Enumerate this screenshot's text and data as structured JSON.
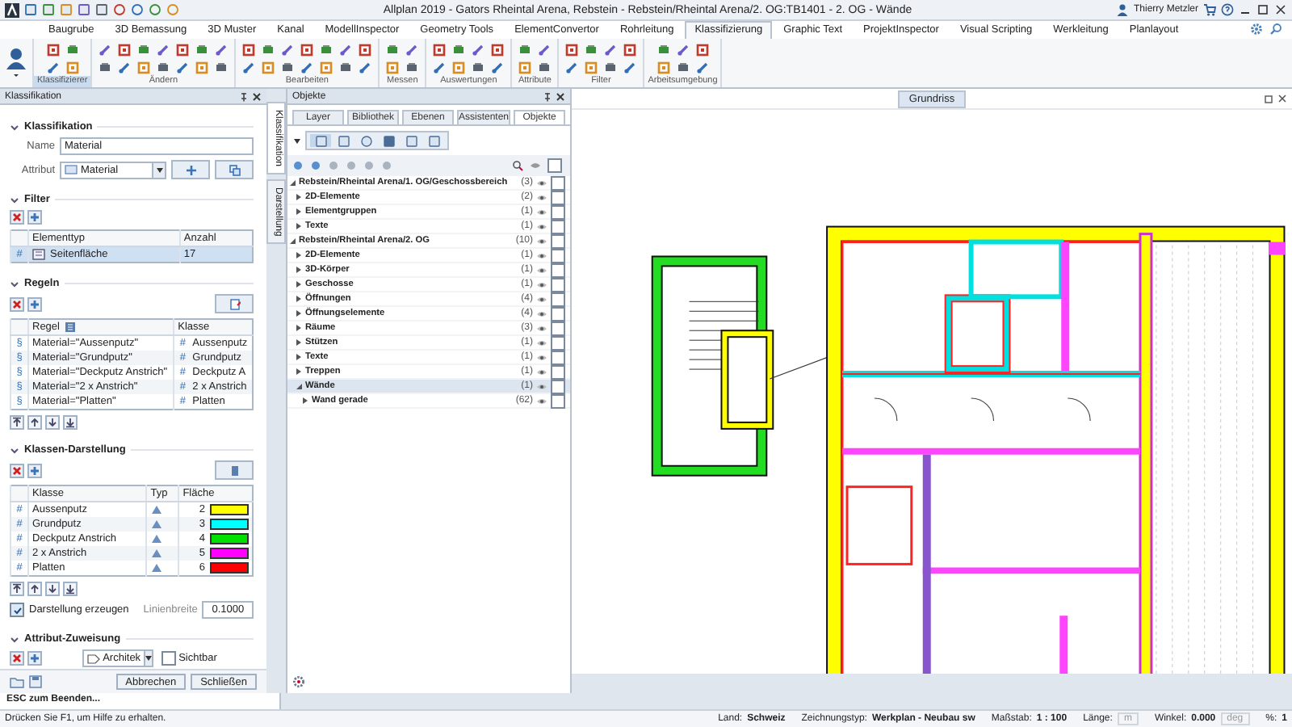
{
  "window": {
    "title": "Allplan 2019 - Gators Rheintal Arena, Rebstein - Rebstein/Rheintal Arena/2. OG:TB1401 - 2. OG - Wände",
    "user": "Thierry Metzler"
  },
  "ribbon": {
    "tabs": [
      {
        "label": "Baugrube",
        "selected": false
      },
      {
        "label": "3D Bemassung",
        "selected": false
      },
      {
        "label": "3D Muster",
        "selected": false
      },
      {
        "label": "Kanal",
        "selected": false
      },
      {
        "label": "ModellInspector",
        "selected": false
      },
      {
        "label": "Geometry Tools",
        "selected": false
      },
      {
        "label": "ElementConvertor",
        "selected": false
      },
      {
        "label": "Rohrleitung",
        "selected": false
      },
      {
        "label": "Klassifizierung",
        "selected": true
      },
      {
        "label": "Graphic Text",
        "selected": false
      },
      {
        "label": "ProjektInspector",
        "selected": false
      },
      {
        "label": "Visual Scripting",
        "selected": false
      },
      {
        "label": "Werkleitung",
        "selected": false
      },
      {
        "label": "Planlayout",
        "selected": false
      }
    ],
    "groups": [
      {
        "label": "Klassifizierer",
        "selected": true
      },
      {
        "label": "Ändern",
        "selected": false
      },
      {
        "label": "Bearbeiten",
        "selected": false
      },
      {
        "label": "Messen",
        "selected": false
      },
      {
        "label": "Auswertungen",
        "selected": false
      },
      {
        "label": "Attribute",
        "selected": false
      },
      {
        "label": "Filter",
        "selected": false
      },
      {
        "label": "Arbeitsumgebung",
        "selected": false
      }
    ]
  },
  "klassifikation_panel": {
    "title": "Klassifikation",
    "side_tabs": [
      {
        "label": "Klassifikation",
        "selected": true
      },
      {
        "label": "Darstellung",
        "selected": false
      }
    ],
    "klassifikation": {
      "heading": "Klassifikation",
      "name_label": "Name",
      "name_value": "Material",
      "attribut_label": "Attribut",
      "attribut_value": "Material"
    },
    "filter": {
      "heading": "Filter",
      "columns": [
        "Elementtyp",
        "Anzahl"
      ],
      "rows": [
        {
          "marker": "#",
          "cells": [
            "Seitenfläche",
            "17"
          ],
          "selected": true
        }
      ]
    },
    "regeln": {
      "heading": "Regeln",
      "columns": [
        "Regel",
        "Klasse"
      ],
      "rows": [
        {
          "marker": "§",
          "regel": "Material=\"Aussenputz\"",
          "klasse_marker": "#",
          "klasse": "Aussenputz"
        },
        {
          "marker": "§",
          "regel": "Material=\"Grundputz\"",
          "klasse_marker": "#",
          "klasse": "Grundputz"
        },
        {
          "marker": "§",
          "regel": "Material=\"Deckputz Anstrich\"",
          "klasse_marker": "#",
          "klasse": "Deckputz A"
        },
        {
          "marker": "§",
          "regel": "Material=\"2 x Anstrich\"",
          "klasse_marker": "#",
          "klasse": "2 x Anstrich"
        },
        {
          "marker": "§",
          "regel": "Material=\"Platten\"",
          "klasse_marker": "#",
          "klasse": "Platten"
        }
      ]
    },
    "klassen": {
      "heading": "Klassen-Darstellung",
      "columns": [
        "Klasse",
        "Typ",
        "Fläche"
      ],
      "rows": [
        {
          "marker": "#",
          "klasse": "Aussenputz",
          "number": "2",
          "color": "#ffff00"
        },
        {
          "marker": "#",
          "klasse": "Grundputz",
          "number": "3",
          "color": "#00ffff"
        },
        {
          "marker": "#",
          "klasse": "Deckputz Anstrich",
          "number": "4",
          "color": "#00e000"
        },
        {
          "marker": "#",
          "klasse": "2 x Anstrich",
          "number": "5",
          "color": "#ff00ff"
        },
        {
          "marker": "#",
          "klasse": "Platten",
          "number": "6",
          "color": "#ff0000"
        }
      ]
    },
    "darstellung_erzeugen": {
      "label": "Darstellung erzeugen",
      "checked": true
    },
    "linienbreite": {
      "label": "Linienbreite",
      "value": "0.1000"
    },
    "attribut_zuweisung": {
      "heading": "Attribut-Zuweisung",
      "dropdown": "Architek",
      "sichtbar": {
        "label": "Sichtbar",
        "checked": false
      }
    },
    "buttons": [
      "Abbrechen",
      "Schließen"
    ]
  },
  "objekte_panel": {
    "title": "Objekte",
    "all_checked": false,
    "tabs": [
      {
        "label": "Layer",
        "selected": false
      },
      {
        "label": "Bibliothek",
        "selected": false
      },
      {
        "label": "Ebenen",
        "selected": false
      },
      {
        "label": "Assistenten",
        "selected": false
      },
      {
        "label": "Objekte",
        "selected": true
      }
    ],
    "tree": [
      {
        "label": "Rebstein/Rheintal Arena/1. OG/Geschossbereich",
        "count": "(3)",
        "expanded": true,
        "selected": false,
        "children": [
          {
            "label": "2D-Elemente",
            "count": "(2)",
            "expanded": false,
            "selected": false
          },
          {
            "label": "Elementgruppen",
            "count": "(1)",
            "expanded": false,
            "selected": false
          },
          {
            "label": "Texte",
            "count": "(1)",
            "expanded": false,
            "selected": false
          }
        ]
      },
      {
        "label": "Rebstein/Rheintal Arena/2. OG",
        "count": "(10)",
        "expanded": true,
        "selected": false,
        "children": [
          {
            "label": "2D-Elemente",
            "count": "(1)",
            "expanded": false,
            "selected": false
          },
          {
            "label": "3D-Körper",
            "count": "(1)",
            "expanded": false,
            "selected": false
          },
          {
            "label": "Geschosse",
            "count": "(1)",
            "expanded": false,
            "selected": false
          },
          {
            "label": "Öffnungen",
            "count": "(4)",
            "expanded": false,
            "selected": false
          },
          {
            "label": "Öffnungselemente",
            "count": "(4)",
            "expanded": false,
            "selected": false
          },
          {
            "label": "Räume",
            "count": "(3)",
            "expanded": false,
            "selected": false
          },
          {
            "label": "Stützen",
            "count": "(1)",
            "expanded": false,
            "selected": false
          },
          {
            "label": "Texte",
            "count": "(1)",
            "expanded": false,
            "selected": false
          },
          {
            "label": "Treppen",
            "count": "(1)",
            "expanded": false,
            "selected": false
          },
          {
            "label": "Wände",
            "count": "(1)",
            "expanded": true,
            "selected": true,
            "children": [
              {
                "label": "Wand gerade",
                "count": "(62)",
                "expanded": false,
                "selected": false
              }
            ]
          }
        ]
      }
    ]
  },
  "drawing": {
    "tab": "Grundriss"
  },
  "status": {
    "esc_tab": "ESC zum Beenden...",
    "hint": "Drücken Sie F1, um Hilfe zu erhalten.",
    "fields": [
      {
        "label": "Land:",
        "value": "Schweiz"
      },
      {
        "label": "Zeichnungstyp:",
        "value": "Werkplan  -  Neubau sw"
      },
      {
        "label": "Maßstab:",
        "value": "1 : 100"
      },
      {
        "label": "Länge:",
        "unit": "m"
      },
      {
        "label": "Winkel:",
        "value": "0.000",
        "unit": "deg"
      },
      {
        "label": "%:",
        "value": "1"
      }
    ]
  }
}
